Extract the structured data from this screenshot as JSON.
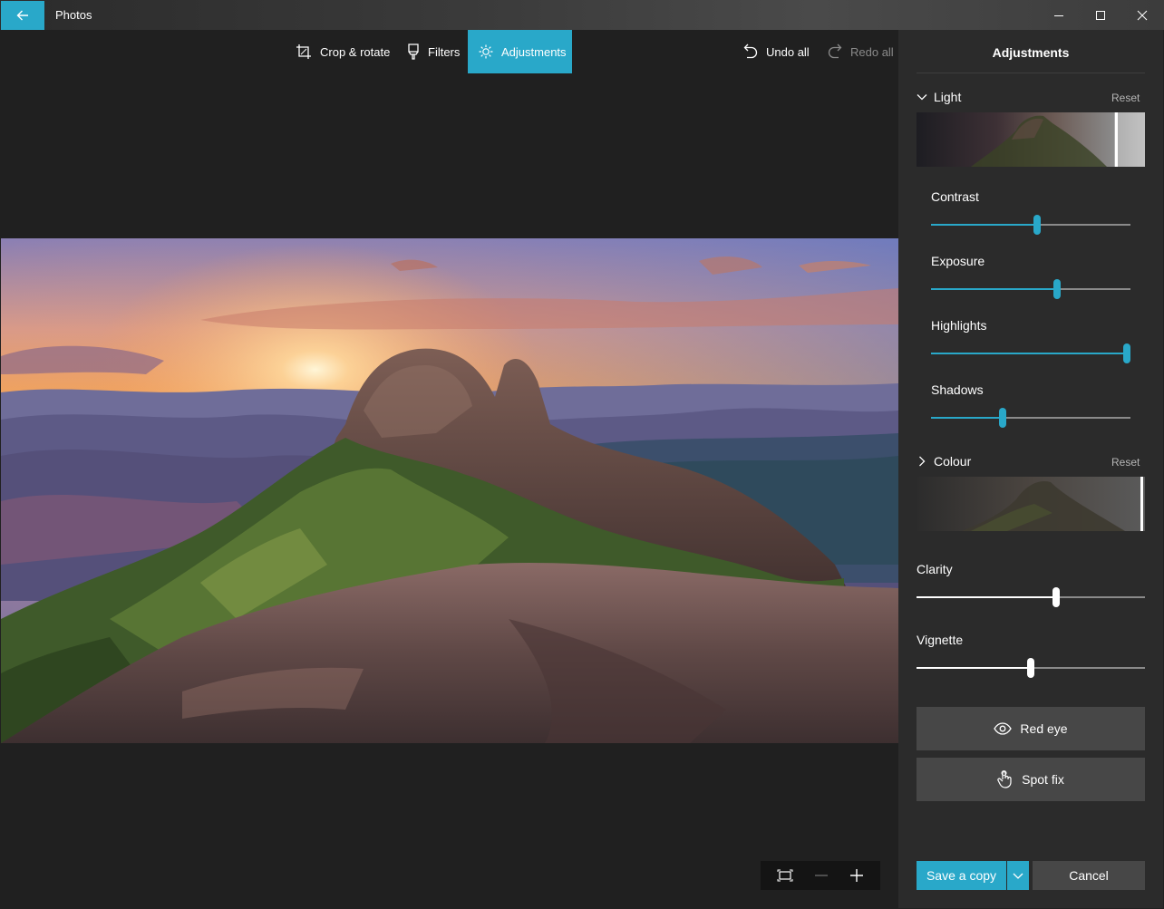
{
  "window": {
    "title": "Photos"
  },
  "toolbar": {
    "crop_label": "Crop & rotate",
    "filters_label": "Filters",
    "adjustments_label": "Adjustments",
    "undo_label": "Undo all",
    "redo_label": "Redo all"
  },
  "panel": {
    "title": "Adjustments",
    "light": {
      "label": "Light",
      "reset": "Reset"
    },
    "colour": {
      "label": "Colour",
      "reset": "Reset"
    },
    "sliders": [
      {
        "label": "Contrast",
        "value": 0.53
      },
      {
        "label": "Exposure",
        "value": 0.63
      },
      {
        "label": "Highlights",
        "value": 0.98
      },
      {
        "label": "Shadows",
        "value": 0.36
      }
    ],
    "clarity": {
      "label": "Clarity",
      "value": 0.61
    },
    "vignette": {
      "label": "Vignette",
      "value": 0.5
    },
    "red_eye_label": "Red eye",
    "spot_fix_label": "Spot fix",
    "save_label": "Save a copy",
    "cancel_label": "Cancel"
  },
  "colors": {
    "accent": "#29a8c9",
    "panel_bg": "#2b2b2b",
    "app_bg": "#202020",
    "button_bg": "#474747"
  },
  "icons": [
    "back-arrow-icon",
    "minimize-icon",
    "maximize-icon",
    "close-icon",
    "crop-icon",
    "filters-icon",
    "brightness-icon",
    "undo-icon",
    "redo-icon",
    "chevron-down-icon",
    "chevron-right-icon",
    "eye-icon",
    "touch-hand-icon",
    "fit-screen-icon",
    "zoom-out-icon",
    "zoom-in-icon"
  ]
}
